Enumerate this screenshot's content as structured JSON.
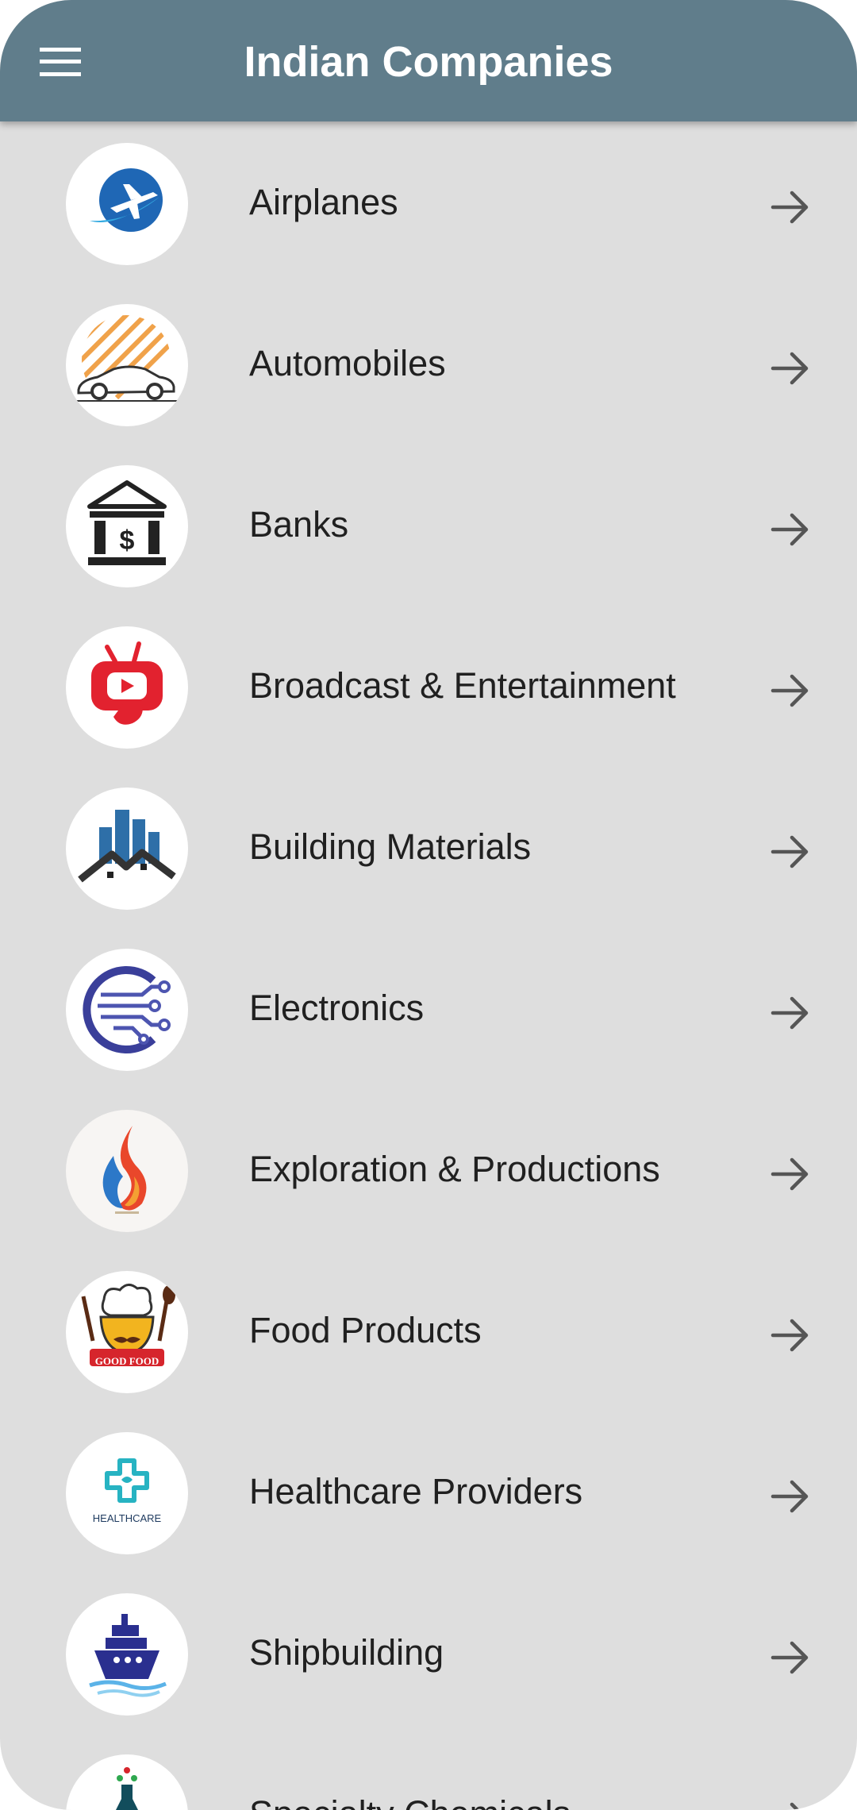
{
  "app": {
    "title": "Indian Companies",
    "menu_icon": "hamburger-menu-icon",
    "header_color": "#607d8b",
    "background_color": "#dedede"
  },
  "categories": [
    {
      "label": "Airplanes",
      "icon": "airplane-icon"
    },
    {
      "label": "Automobiles",
      "icon": "car-icon"
    },
    {
      "label": "Banks",
      "icon": "bank-icon"
    },
    {
      "label": "Broadcast & Entertainment",
      "icon": "tv-icon"
    },
    {
      "label": "Building Materials",
      "icon": "buildings-icon"
    },
    {
      "label": "Electronics",
      "icon": "circuit-icon"
    },
    {
      "label": "Exploration & Productions",
      "icon": "flame-icon"
    },
    {
      "label": "Food Products",
      "icon": "chef-icon"
    },
    {
      "label": "Healthcare Providers",
      "icon": "healthcare-cross-icon"
    },
    {
      "label": "Shipbuilding",
      "icon": "ship-icon"
    },
    {
      "label": "Specialty Chemicals",
      "icon": "chemical-icon"
    }
  ],
  "logo_texts": {
    "food": "GOOD FOOD",
    "healthcare": "HEALTHCARE"
  },
  "row_arrow_icon": "arrow-right-icon"
}
